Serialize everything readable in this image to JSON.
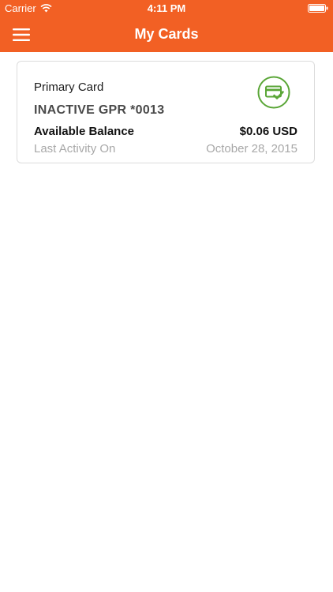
{
  "status_bar": {
    "carrier": "Carrier",
    "time": "4:11 PM",
    "icons": [
      "wifi-icon",
      "battery-icon"
    ]
  },
  "nav": {
    "title": "My Cards",
    "menu_icon": "hamburger-menu-icon"
  },
  "card": {
    "label": "Primary Card",
    "name": "INACTIVE GPR *0013",
    "status_icon": "card-check-icon",
    "balance_label": "Available Balance",
    "balance_value": "$0.06 USD",
    "activity_label": "Last Activity On",
    "activity_value": "October 28, 2015"
  },
  "colors": {
    "brand": "#f26024",
    "status_green": "#5aa637",
    "muted_text": "#a8a8a8"
  }
}
